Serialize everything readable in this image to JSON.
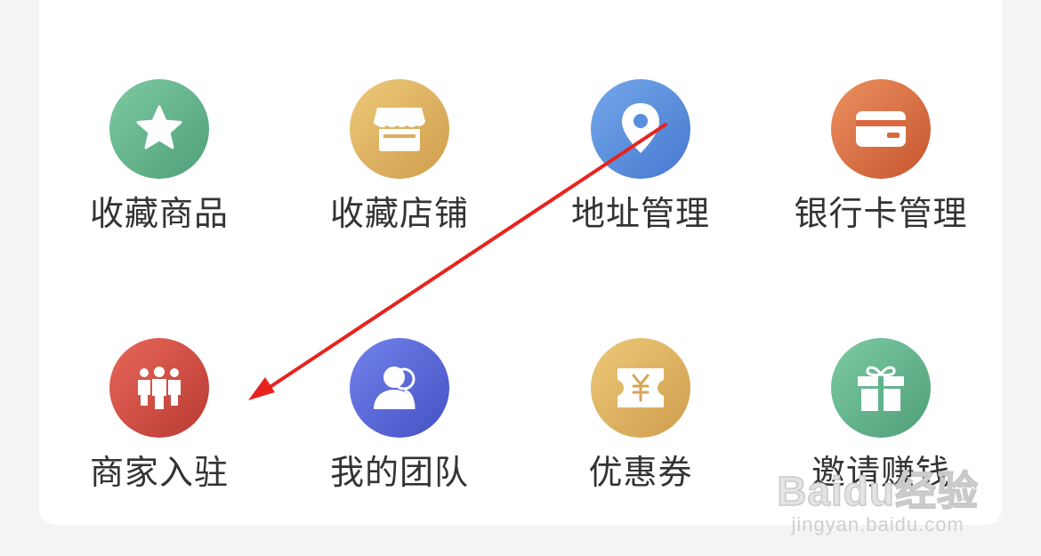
{
  "menu": {
    "items": [
      {
        "label": "收藏商品",
        "icon": "star-icon",
        "color": "#5fb38b"
      },
      {
        "label": "收藏店铺",
        "icon": "store-icon",
        "color": "#e0b565"
      },
      {
        "label": "地址管理",
        "icon": "location-pin-icon",
        "color": "#5a8fdd"
      },
      {
        "label": "银行卡管理",
        "icon": "bank-card-icon",
        "color": "#db7248"
      },
      {
        "label": "商家入驻",
        "icon": "people-group-icon",
        "color": "#d4514a"
      },
      {
        "label": "我的团队",
        "icon": "team-user-icon",
        "color": "#5a66d8"
      },
      {
        "label": "优惠券",
        "icon": "coupon-yen-icon",
        "color": "#e0b565"
      },
      {
        "label": "邀请赚钱",
        "icon": "gift-icon",
        "color": "#5fb38b"
      }
    ]
  },
  "annotation": {
    "arrow_color": "#e8231e"
  },
  "watermark": {
    "logo": "Baidu经验",
    "url": "jingyan.baidu.com"
  }
}
